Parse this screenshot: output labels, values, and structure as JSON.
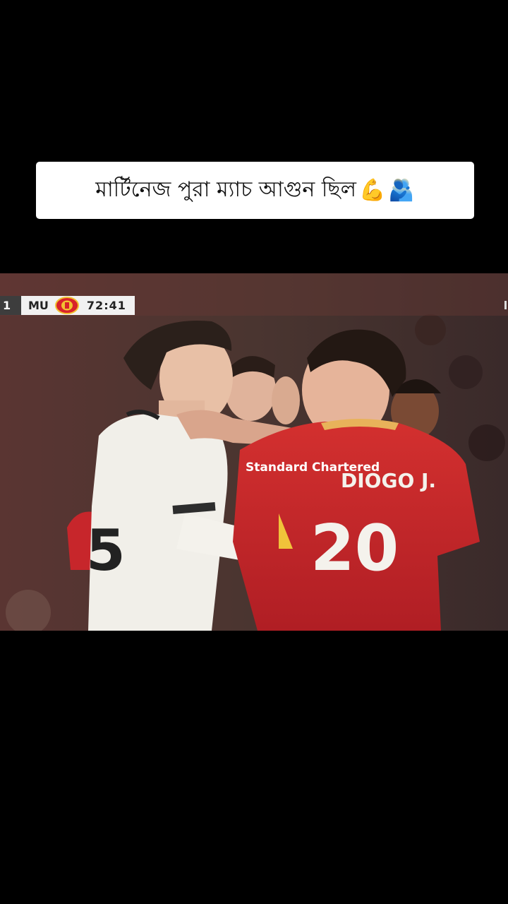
{
  "caption": {
    "text": "মার্টিনেজ পুরা ম্যাচ আগুন ছিল",
    "emoji_1": "💪",
    "emoji_2": "🫂"
  },
  "scoreboard": {
    "score": "1",
    "team": "MU",
    "clock": "72:41",
    "crest_icon": "man-utd-crest-icon"
  },
  "video": {
    "jersey_name": "DIOGO J.",
    "jersey_number": "20",
    "sponsor": "Standard Chartered",
    "white_shirt_number": "5",
    "colors": {
      "red_kit": "#c7262b",
      "white_kit": "#f1efe9",
      "background": "#4a2e2c"
    }
  }
}
